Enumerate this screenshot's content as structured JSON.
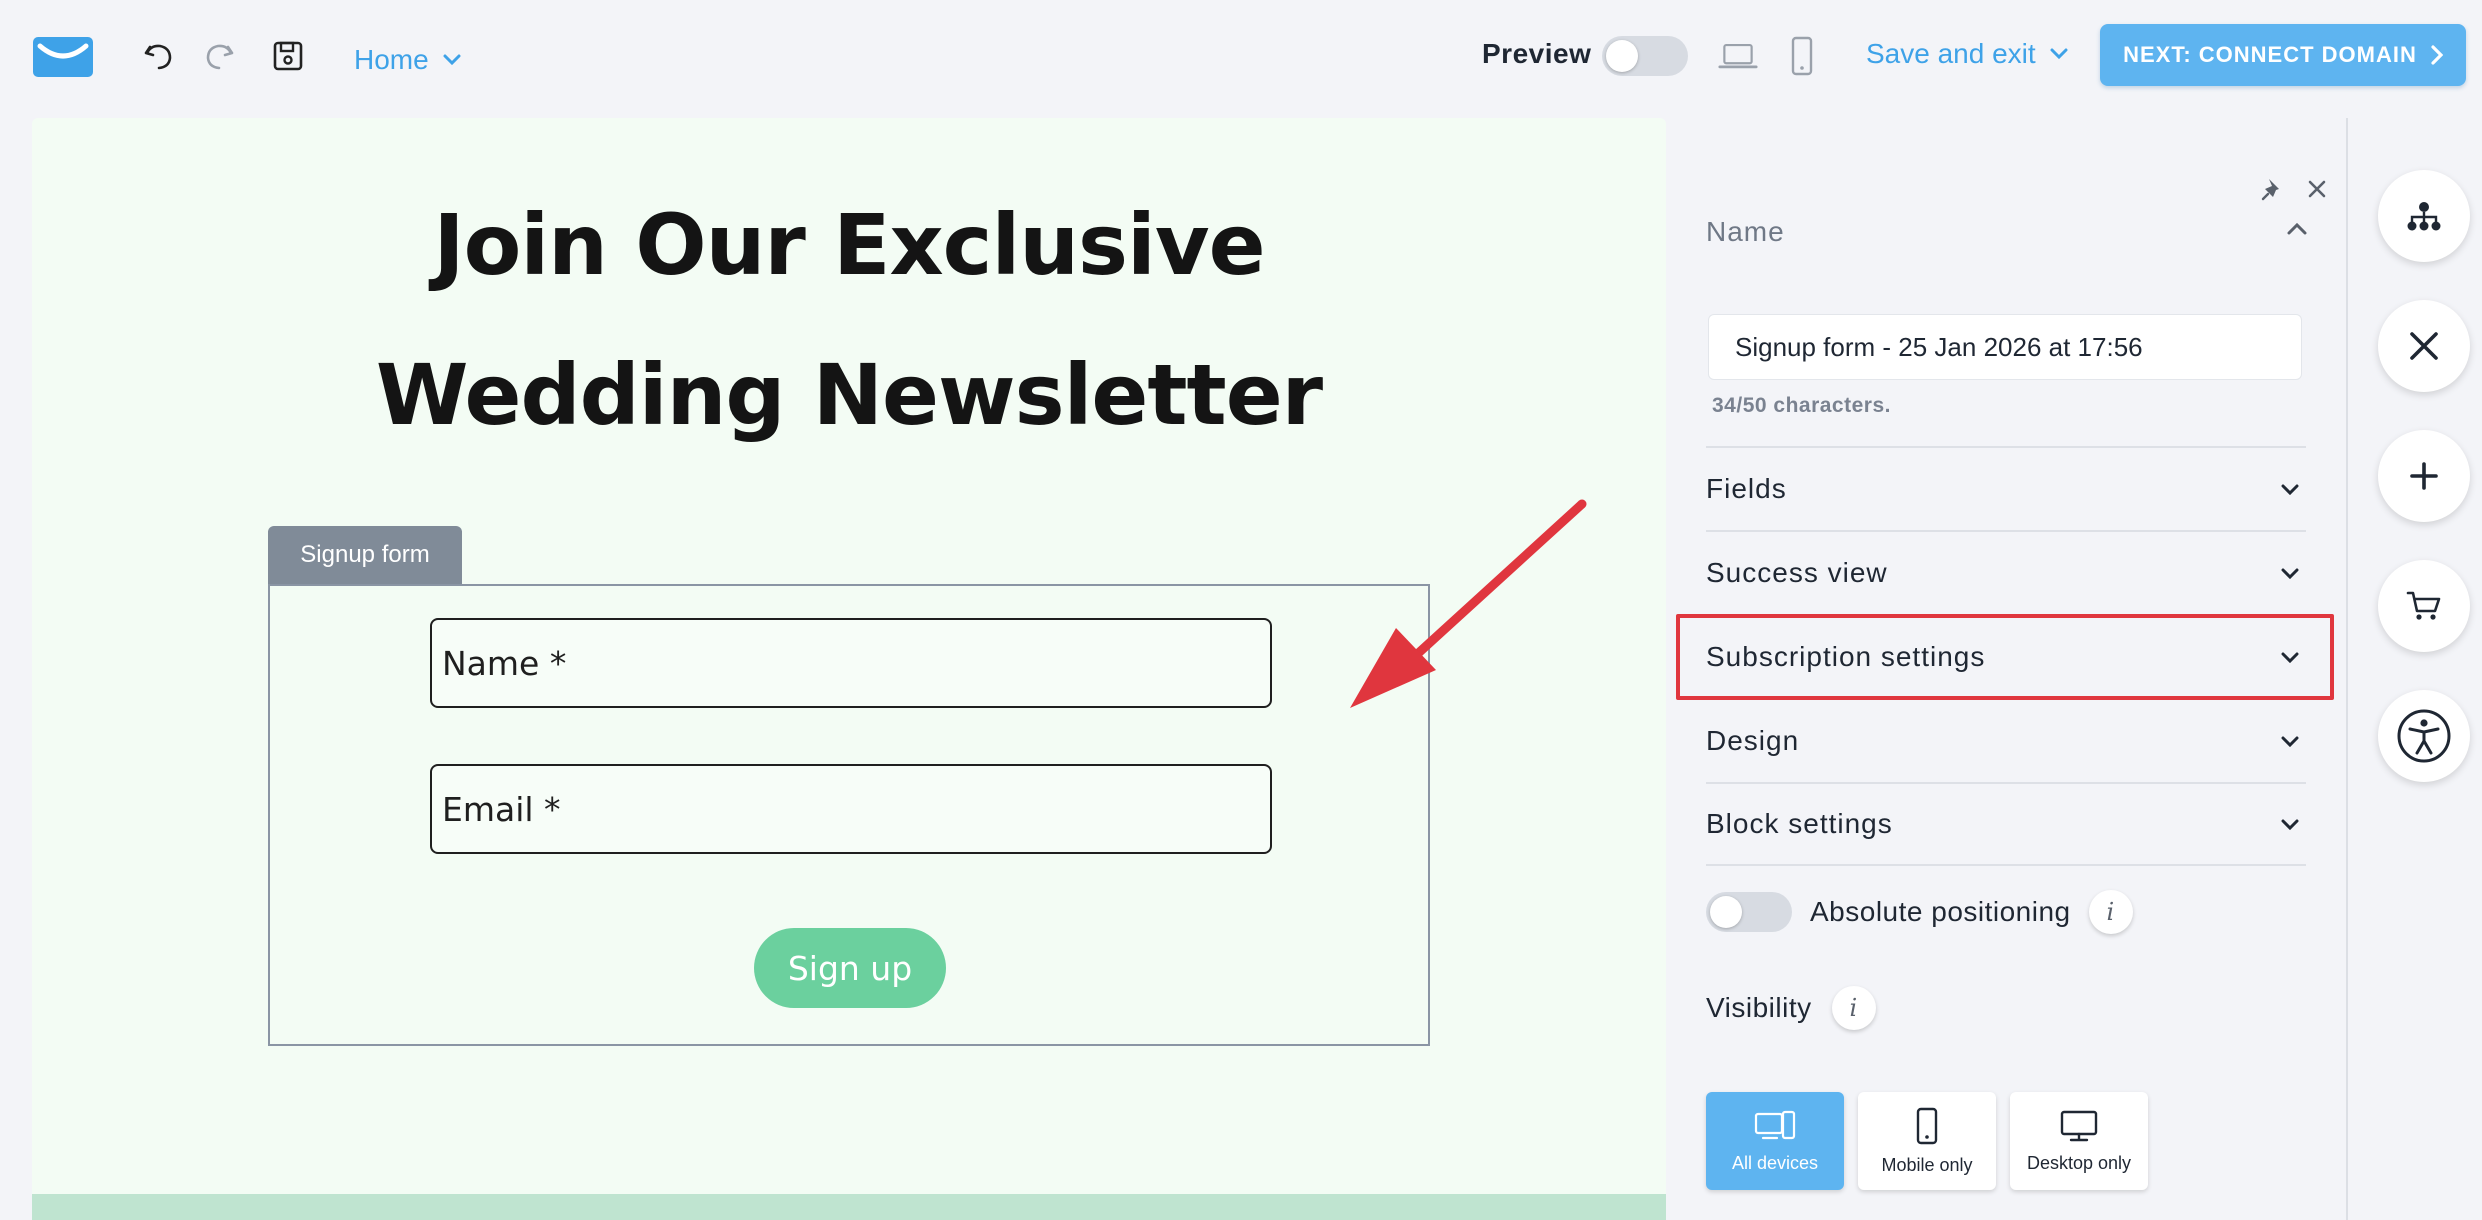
{
  "toolbar": {
    "home_label": "Home",
    "preview_label": "Preview",
    "save_exit_label": "Save and exit",
    "next_label": "NEXT: CONNECT DOMAIN",
    "accent_color": "#3ea2e8"
  },
  "canvas": {
    "headline_line1": "Join Our Exclusive",
    "headline_line2": "Wedding Newsletter",
    "form_tab_label": "Signup form",
    "fields": [
      "Name *",
      "Email *"
    ],
    "button_label": "Sign up",
    "background_color": "#f3fcf4",
    "button_color": "#6bd09e"
  },
  "panel": {
    "name_section_label": "Name",
    "name_value": "Signup form - 25 Jan 2026 at 17:56",
    "char_count": "34/50 characters.",
    "sections": [
      "Fields",
      "Success view",
      "Subscription settings",
      "Design",
      "Block settings"
    ],
    "highlighted_section": "Subscription settings",
    "absolute_positioning_label": "Absolute positioning",
    "visibility_label": "Visibility",
    "visibility_options": [
      "All devices",
      "Mobile only",
      "Desktop only"
    ],
    "selected_visibility": "All devices"
  },
  "rail": {
    "icons": [
      "sitemap-icon",
      "tools-icon",
      "add-icon",
      "cart-icon",
      "accessibility-icon"
    ]
  }
}
